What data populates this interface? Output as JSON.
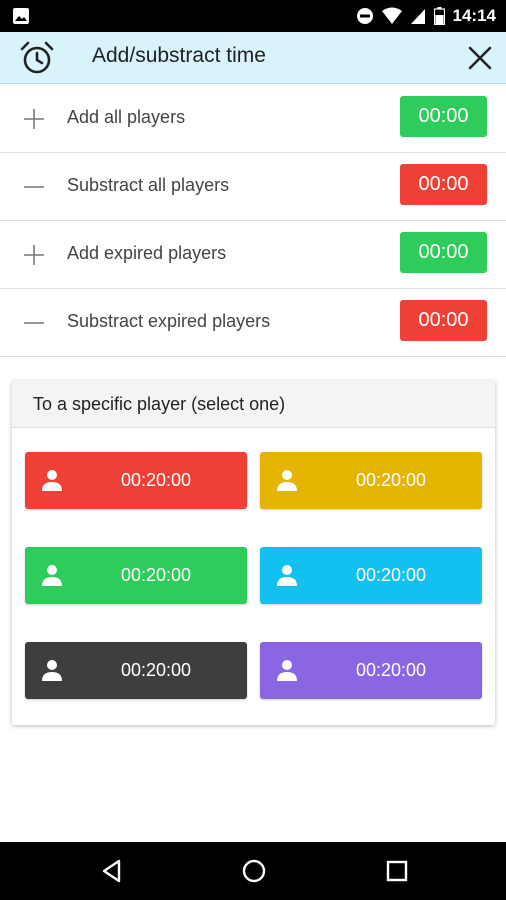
{
  "status_bar": {
    "time": "14:14"
  },
  "header": {
    "title": "Add/substract time"
  },
  "actions": [
    {
      "label": "Add all players",
      "sign": "plus",
      "value": "00:00",
      "color": "#2ecc5a"
    },
    {
      "label": "Substract all players",
      "sign": "minus",
      "value": "00:00",
      "color": "#ee4036"
    },
    {
      "label": "Add expired players",
      "sign": "plus",
      "value": "00:00",
      "color": "#2ecc5a"
    },
    {
      "label": "Substract expired players",
      "sign": "minus",
      "value": "00:00",
      "color": "#ee4036"
    }
  ],
  "specific": {
    "title": "To a specific player (select one)",
    "players": [
      {
        "time": "00:20:00",
        "color": "#ee4036"
      },
      {
        "time": "00:20:00",
        "color": "#e5b400"
      },
      {
        "time": "00:20:00",
        "color": "#2ecc5a"
      },
      {
        "time": "00:20:00",
        "color": "#13c1f1"
      },
      {
        "time": "00:20:00",
        "color": "#3e3e3e"
      },
      {
        "time": "00:20:00",
        "color": "#8a66e3"
      }
    ]
  }
}
